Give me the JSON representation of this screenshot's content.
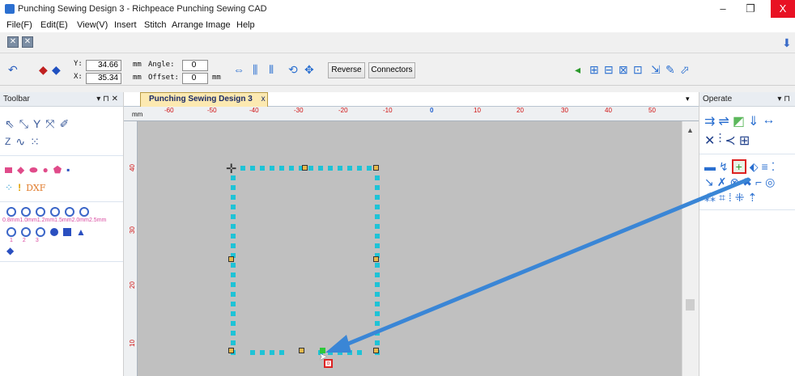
{
  "window": {
    "title": "Punching Sewing Design 3 - Richpeace Punching Sewing CAD",
    "controls": {
      "minimize": "–",
      "restore": "❐",
      "close": "X"
    }
  },
  "menu": [
    "File(F)",
    "Edit(E)",
    "View(V)",
    "Insert",
    "Stitch",
    "Arrange",
    "Image",
    "Help"
  ],
  "toolbar": {
    "y_label": "Y:",
    "y_value": "34.66",
    "x_label": "X:",
    "x_value": "35.34",
    "unit1": "mm",
    "unit2": "mm",
    "unit3": "mm",
    "angle_label": "Angle:",
    "angle_value": "0",
    "offset_label": "Offset:",
    "offset_value": "0",
    "reverse_label": "Reverse",
    "connectors_label": "Connectors"
  },
  "left_panel": {
    "title": "Toolbar",
    "controls": "▾ ⊓ ✕",
    "dxf_label": "DXF",
    "sizes_label": "0.8mm1.0mm1.2mm1.5mm2.0mm2.5mm",
    "nums": [
      "1",
      "2",
      "3"
    ]
  },
  "document": {
    "tab_label": "Punching Sewing Design 3",
    "tab_close": "x",
    "ruler_unit": "mm",
    "h_ticks": [
      "-60",
      "-50",
      "-40",
      "-30",
      "-20",
      "-10",
      "0",
      "10",
      "20",
      "30",
      "40",
      "50"
    ],
    "v_ticks": [
      "40",
      "30",
      "20",
      "10"
    ]
  },
  "right_panel": {
    "title": "Operate",
    "controls": "▾ ⊓"
  },
  "colors": {
    "stitch": "#1ec3d6",
    "node": "#e7b84a",
    "arrow": "#3a86d6",
    "workspace": "#c0c0c0"
  }
}
